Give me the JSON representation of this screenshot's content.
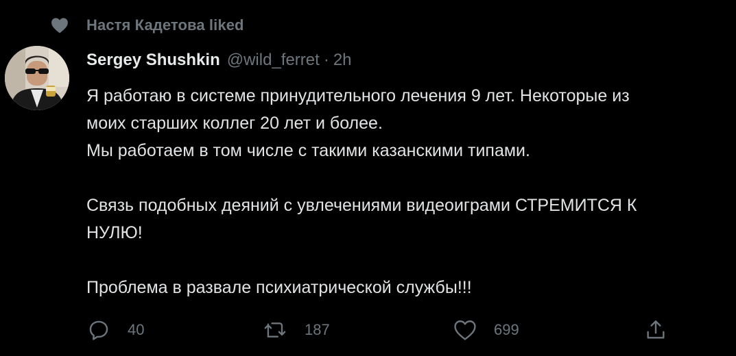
{
  "social_context": {
    "icon": "heart-icon",
    "text": "Настя Кадетова liked"
  },
  "tweet": {
    "author_name": "Sergey Shushkin",
    "handle": "@wild_ferret",
    "separator": "·",
    "time": "2h",
    "lines": [
      "Я работаю в системе принудительного лечения 9 лет. Некоторые из",
      "моих старших коллег 20 лет и более.",
      "Мы работаем в том числе с такими казанскими типами.",
      "Связь подобных деяний с увлечениями видеоиграми СТРЕМИТСЯ К",
      "НУЛЮ!",
      "Проблема в развале психиатрической службы!!!"
    ]
  },
  "actions": {
    "reply_count": "40",
    "retweet_count": "187",
    "like_count": "699"
  },
  "colors": {
    "background": "#000000",
    "text": "#e1e3e5",
    "muted": "#6e767d"
  }
}
